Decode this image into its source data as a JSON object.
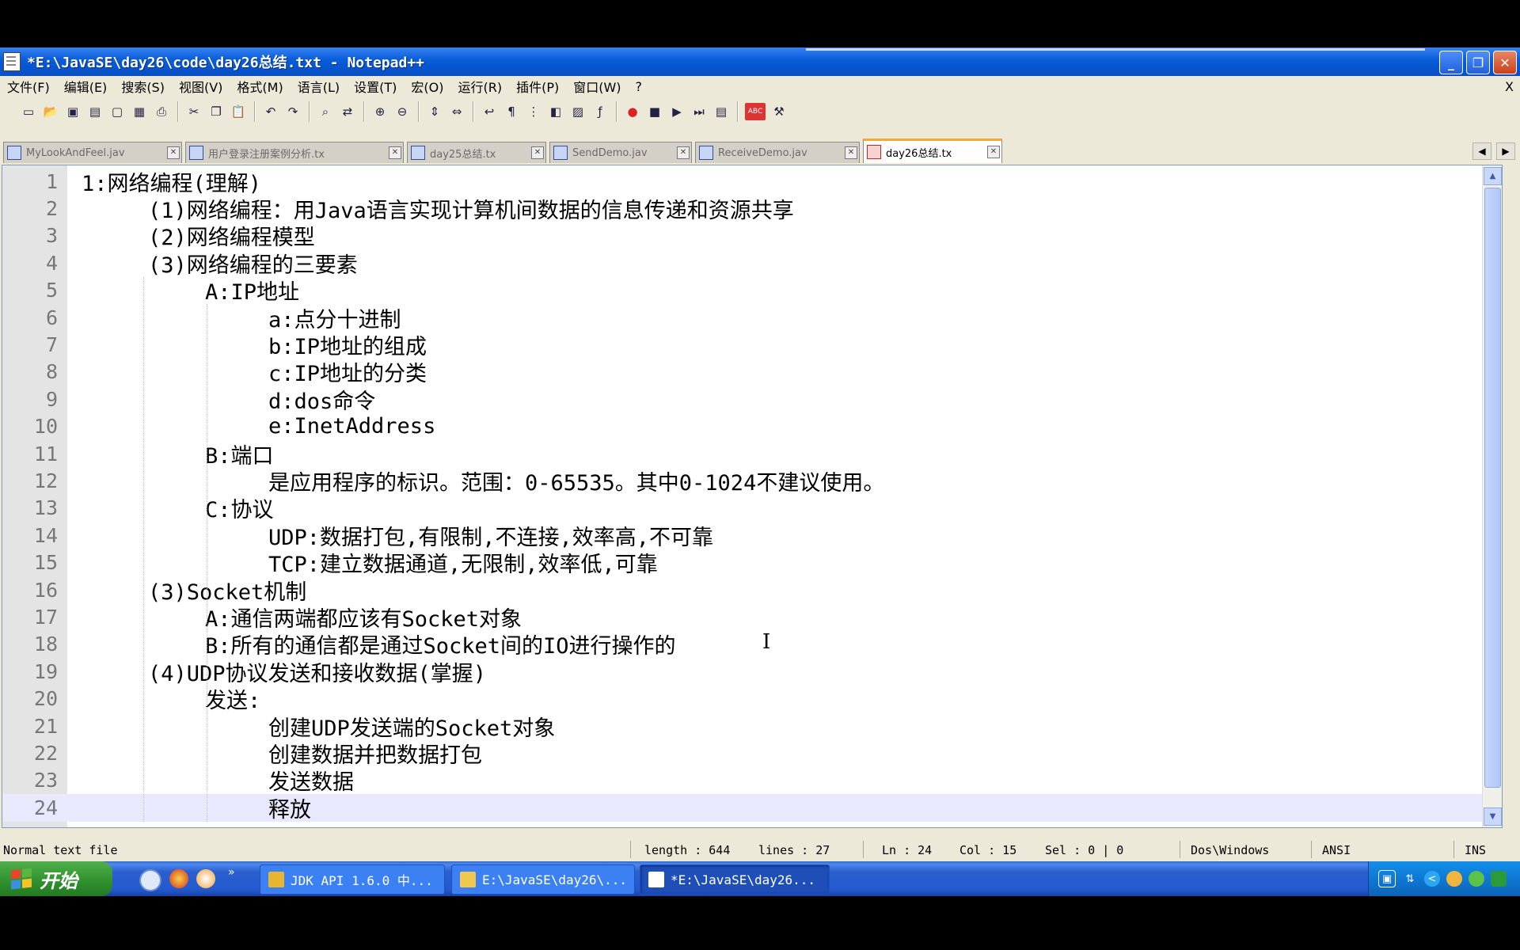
{
  "window": {
    "title": "*E:\\JavaSE\\day26\\code\\day26总结.txt - Notepad++"
  },
  "menu": [
    "文件(F)",
    "编辑(E)",
    "搜索(S)",
    "视图(V)",
    "格式(M)",
    "语言(L)",
    "设置(T)",
    "宏(O)",
    "运行(R)",
    "插件(P)",
    "窗口(W)",
    "?"
  ],
  "menu_close": "X",
  "toolbar": {
    "icons": [
      "new-file-icon",
      "open-file-icon",
      "save-icon",
      "save-all-icon",
      "close-icon",
      "close-all-icon",
      "print-icon",
      "cut-icon",
      "copy-icon",
      "paste-icon",
      "undo-icon",
      "redo-icon",
      "find-icon",
      "replace-icon",
      "zoom-in-icon",
      "zoom-out-icon",
      "sync-vertical-icon",
      "sync-horizontal-icon",
      "word-wrap-icon",
      "show-all-chars-icon",
      "indent-guide-icon",
      "user-lang-icon",
      "doc-map-icon",
      "function-list-icon",
      "record-macro-icon",
      "stop-macro-icon",
      "play-macro-icon",
      "run-macro-multiple-icon",
      "save-macro-icon",
      "spell-check-icon",
      "wrench-icon"
    ],
    "spell_label": "ABC"
  },
  "tabs": [
    {
      "label": "MyLookAndFeel.jav",
      "active": false
    },
    {
      "label": "用户登录注册案例分析.tx",
      "active": false
    },
    {
      "label": "day25总结.tx",
      "active": false
    },
    {
      "label": "SendDemo.jav",
      "active": false
    },
    {
      "label": "ReceiveDemo.jav",
      "active": false
    },
    {
      "label": "day26总结.tx",
      "active": true
    }
  ],
  "tab_close_glyph": "✕",
  "tab_scroll": {
    "left": "◀",
    "right": "▶"
  },
  "editor": {
    "current_line": 24,
    "lines": [
      {
        "n": "1",
        "indent": 0,
        "text": "1:网络编程(理解)"
      },
      {
        "n": "2",
        "indent": 1,
        "text": "(1)网络编程：用Java语言实现计算机间数据的信息传递和资源共享"
      },
      {
        "n": "3",
        "indent": 1,
        "text": "(2)网络编程模型"
      },
      {
        "n": "4",
        "indent": 1,
        "text": "(3)网络编程的三要素"
      },
      {
        "n": "5",
        "indent": 2,
        "text": "A:IP地址"
      },
      {
        "n": "6",
        "indent": 3,
        "text": "a:点分十进制"
      },
      {
        "n": "7",
        "indent": 3,
        "text": "b:IP地址的组成"
      },
      {
        "n": "8",
        "indent": 3,
        "text": "c:IP地址的分类"
      },
      {
        "n": "9",
        "indent": 3,
        "text": "d:dos命令"
      },
      {
        "n": "10",
        "indent": 3,
        "text": "e:InetAddress"
      },
      {
        "n": "11",
        "indent": 2,
        "text": "B:端口"
      },
      {
        "n": "12",
        "indent": 3,
        "text": "是应用程序的标识。范围：0-65535。其中0-1024不建议使用。"
      },
      {
        "n": "13",
        "indent": 2,
        "text": "C:协议"
      },
      {
        "n": "14",
        "indent": 3,
        "text": "UDP:数据打包,有限制,不连接,效率高,不可靠"
      },
      {
        "n": "15",
        "indent": 3,
        "text": "TCP:建立数据通道,无限制,效率低,可靠"
      },
      {
        "n": "16",
        "indent": 1,
        "text": "(3)Socket机制"
      },
      {
        "n": "17",
        "indent": 2,
        "text": "A:通信两端都应该有Socket对象"
      },
      {
        "n": "18",
        "indent": 2,
        "text": "B:所有的通信都是通过Socket间的IO进行操作的"
      },
      {
        "n": "19",
        "indent": 1,
        "text": "(4)UDP协议发送和接收数据(掌握)"
      },
      {
        "n": "20",
        "indent": 2,
        "text": "发送:"
      },
      {
        "n": "21",
        "indent": 3,
        "text": "创建UDP发送端的Socket对象"
      },
      {
        "n": "22",
        "indent": 3,
        "text": "创建数据并把数据打包"
      },
      {
        "n": "23",
        "indent": 3,
        "text": "发送数据"
      },
      {
        "n": "24",
        "indent": 3,
        "text": "释放"
      }
    ]
  },
  "status": {
    "filetype": "Normal text file",
    "length": "length : 644",
    "lines": "lines : 27",
    "ln": "Ln : 24",
    "col": "Col : 15",
    "sel": "Sel : 0 | 0",
    "eol": "Dos\\Windows",
    "encoding": "ANSI",
    "mode": "INS"
  },
  "taskbar": {
    "start_label": "开始",
    "quick_chevron": "»",
    "tasks": [
      {
        "label": "JDK API 1.6.0 中...",
        "active": false
      },
      {
        "label": "E:\\JavaSE\\day26\\...",
        "active": false
      },
      {
        "label": "*E:\\JavaSE\\day26...",
        "active": true
      }
    ]
  },
  "colors": {
    "titlebar": "#0a5fd8",
    "taskbar": "#245ad0",
    "start": "#2f8f2d",
    "tab_active_accent": "#f7a733"
  }
}
